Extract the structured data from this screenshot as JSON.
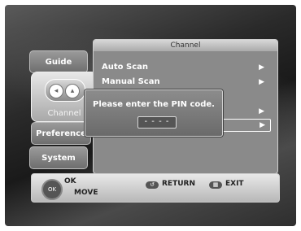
{
  "menu_tabs": {
    "guide": "Guide",
    "channel": "Channel",
    "preference": "Preference",
    "system": "System"
  },
  "panel": {
    "title": "Channel",
    "items": [
      {
        "label": "Auto Scan"
      },
      {
        "label": "Manual Scan"
      },
      {
        "label": ""
      },
      {
        "label": ""
      }
    ]
  },
  "pin_dialog": {
    "prompt": "Please enter the PIN code.",
    "field_value": "- - - -"
  },
  "bottom_bar": {
    "ok_label": "OK",
    "move_label": "MOVE",
    "return_label": "RETURN",
    "exit_label": "EXIT"
  },
  "icons": {
    "arrow": "right-triangle",
    "channel": "channel-icon",
    "nav": "dpad-icon"
  }
}
